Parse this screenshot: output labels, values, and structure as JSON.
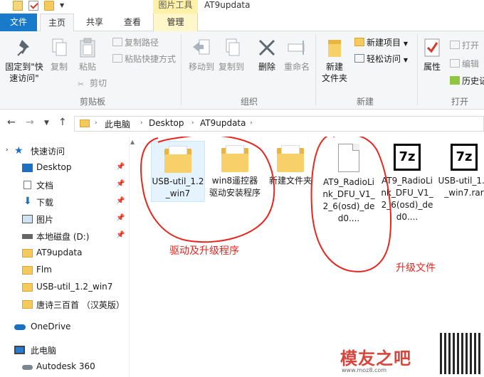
{
  "window": {
    "title": "AT9updata",
    "tools_badge": "图片工具"
  },
  "tabs": {
    "file": "文件",
    "home": "主页",
    "share": "共享",
    "view": "查看",
    "manage": "管理"
  },
  "ribbon": {
    "clipboard": {
      "pin": "固定到\"快速访问\"",
      "copy": "复制",
      "paste": "粘贴",
      "copy_path": "复制路径",
      "paste_shortcut": "粘贴快捷方式",
      "cut": "剪切",
      "label": "剪贴板"
    },
    "organize": {
      "move_to": "移动到",
      "copy_to": "复制到",
      "delete": "删除",
      "rename": "重命名",
      "label": "组织"
    },
    "new": {
      "new_folder": "新建\n文件夹",
      "new_item": "新建项目",
      "easy_access": "轻松访问",
      "label": "新建"
    },
    "open": {
      "properties": "属性",
      "open": "打开",
      "edit": "编辑",
      "history": "历史记",
      "label": "打开"
    }
  },
  "address": {
    "crumbs": [
      "此电脑",
      "Desktop",
      "AT9updata"
    ]
  },
  "nav": {
    "quick_access": "快速访问",
    "items": [
      {
        "label": "Desktop",
        "pinned": true
      },
      {
        "label": "文档",
        "pinned": true
      },
      {
        "label": "下载",
        "pinned": true
      },
      {
        "label": "图片",
        "pinned": true
      },
      {
        "label": "本地磁盘 (D:)",
        "pinned": true
      },
      {
        "label": "AT9updata",
        "pinned": false
      },
      {
        "label": "Flm",
        "pinned": false
      },
      {
        "label": "USB-util_1.2_win7",
        "pinned": false
      },
      {
        "label": "唐诗三百首 （汉英版）",
        "pinned": false
      }
    ],
    "onedrive": "OneDrive",
    "this_pc": "此电脑",
    "autodesk": "Autodesk 360"
  },
  "files": [
    {
      "name": "USB-util_1.2_win7",
      "type": "folder"
    },
    {
      "name": "win8遥控器驱动安装程序",
      "type": "folder"
    },
    {
      "name": "新建文件夹",
      "type": "folder"
    },
    {
      "name": "AT9_RadioLink_DFU_V1_2_6(osd)_ded0....",
      "type": "file"
    },
    {
      "name": "AT9_RadioLink_DFU_V1_2_6(osd)_ded0....",
      "type": "7z"
    },
    {
      "name": "USB-util_1.2_win7.rar",
      "type": "7z"
    }
  ],
  "annotations": {
    "driver": "驱动及升级程序",
    "upgrade": "升级文件"
  },
  "watermark": {
    "text": "模友之吧",
    "url": "www.moz8.com"
  },
  "colors": {
    "file_tab": "#1979ca",
    "annotation": "#e8261f",
    "folder": "#f4c95d"
  }
}
